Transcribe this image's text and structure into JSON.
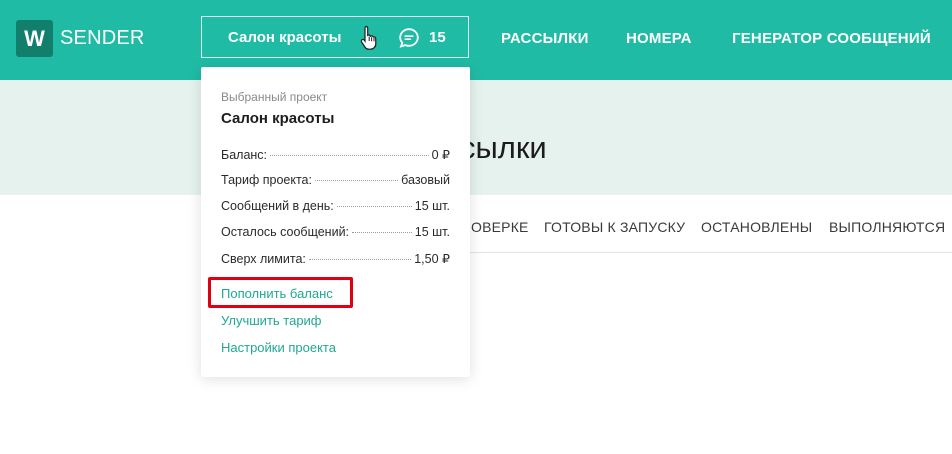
{
  "header": {
    "logo_letter": "W",
    "logo_text": "SENDER",
    "project_name": "Салон красоты",
    "messages_count": "15",
    "nav": [
      "РАССЫЛКИ",
      "НОМЕРА",
      "ГЕНЕРАТОР СООБЩЕНИЙ"
    ]
  },
  "page": {
    "title_visible": "сылки",
    "tabs": [
      "ОВЕРКЕ",
      "ГОТОВЫ К ЗАПУСКУ",
      "ОСТАНОВЛЕНЫ",
      "ВЫПОЛНЯЮТСЯ"
    ]
  },
  "dropdown": {
    "subtitle": "Выбранный проект",
    "title": "Салон красоты",
    "rows": [
      {
        "label": "Баланс:",
        "value": "0 ₽"
      },
      {
        "label": "Тариф проекта:",
        "value": "базовый"
      },
      {
        "label": "Сообщений в день:",
        "value": "15 шт."
      },
      {
        "label": "Осталось сообщений:",
        "value": "15 шт."
      },
      {
        "label": "Сверх лимита:",
        "value": "1,50 ₽"
      }
    ],
    "links": [
      "Пополнить баланс",
      "Улучшить тариф",
      "Настройки проекта"
    ]
  },
  "colors": {
    "brand": "#20bba5",
    "brand_dark": "#127e6c",
    "link": "#20a892",
    "highlight": "#e00012"
  }
}
